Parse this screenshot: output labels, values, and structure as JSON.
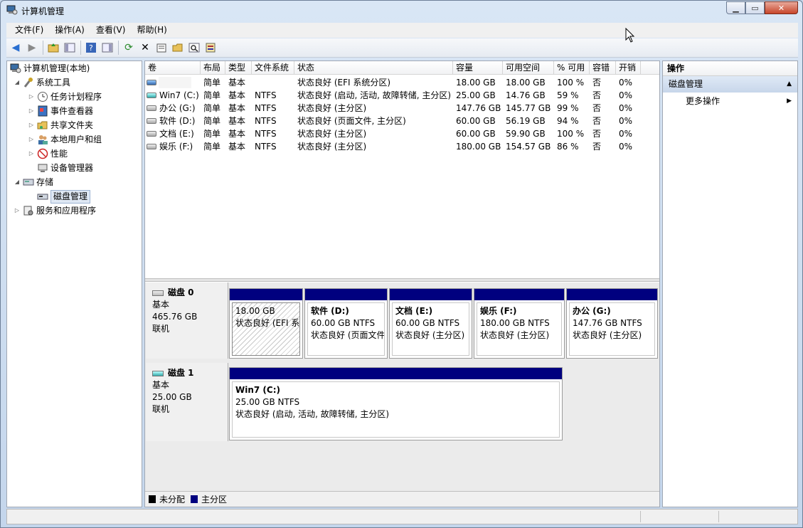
{
  "window": {
    "title": "计算机管理"
  },
  "menu": [
    "文件(F)",
    "操作(A)",
    "查看(V)",
    "帮助(H)"
  ],
  "tree": {
    "root": "计算机管理(本地)",
    "system_tools": "系统工具",
    "task_scheduler": "任务计划程序",
    "event_viewer": "事件查看器",
    "shared_folders": "共享文件夹",
    "local_users": "本地用户和组",
    "performance": "性能",
    "device_manager": "设备管理器",
    "storage": "存储",
    "disk_management": "磁盘管理",
    "services_apps": "服务和应用程序"
  },
  "volumes": {
    "headers": [
      "卷",
      "布局",
      "类型",
      "文件系统",
      "状态",
      "容量",
      "可用空间",
      "% 可用",
      "容错",
      "开销"
    ],
    "rows": [
      [
        "",
        "简单",
        "基本",
        "",
        "状态良好 (EFI 系统分区)",
        "18.00 GB",
        "18.00 GB",
        "100 %",
        "否",
        "0%"
      ],
      [
        "Win7 (C:)",
        "简单",
        "基本",
        "NTFS",
        "状态良好 (启动, 活动, 故障转储, 主分区)",
        "25.00 GB",
        "14.76 GB",
        "59 %",
        "否",
        "0%"
      ],
      [
        "办公 (G:)",
        "简单",
        "基本",
        "NTFS",
        "状态良好 (主分区)",
        "147.76 GB",
        "145.77 GB",
        "99 %",
        "否",
        "0%"
      ],
      [
        "软件 (D:)",
        "简单",
        "基本",
        "NTFS",
        "状态良好 (页面文件, 主分区)",
        "60.00 GB",
        "56.19 GB",
        "94 %",
        "否",
        "0%"
      ],
      [
        "文档 (E:)",
        "简单",
        "基本",
        "NTFS",
        "状态良好 (主分区)",
        "60.00 GB",
        "59.90 GB",
        "100 %",
        "否",
        "0%"
      ],
      [
        "娱乐 (F:)",
        "简单",
        "基本",
        "NTFS",
        "状态良好 (主分区)",
        "180.00 GB",
        "154.57 GB",
        "86 %",
        "否",
        "0%"
      ]
    ]
  },
  "disks": [
    {
      "name": "磁盘 0",
      "type": "基本",
      "size": "465.76 GB",
      "status": "联机",
      "partitions": [
        {
          "name": "",
          "size": "18.00 GB",
          "status": "状态良好 (EFI 系统分区)"
        },
        {
          "name": "软件  (D:)",
          "size": "60.00 GB NTFS",
          "status": "状态良好 (页面文件, 主分区)"
        },
        {
          "name": "文档  (E:)",
          "size": "60.00 GB NTFS",
          "status": "状态良好 (主分区)"
        },
        {
          "name": "娱乐  (F:)",
          "size": "180.00 GB NTFS",
          "status": "状态良好 (主分区)"
        },
        {
          "name": "办公  (G:)",
          "size": "147.76 GB NTFS",
          "status": "状态良好 (主分区)"
        }
      ]
    },
    {
      "name": "磁盘 1",
      "type": "基本",
      "size": "25.00 GB",
      "status": "联机",
      "partitions": [
        {
          "name": "Win7  (C:)",
          "size": "25.00 GB NTFS",
          "status": "状态良好 (启动, 活动, 故障转储, 主分区)"
        }
      ]
    }
  ],
  "legend": {
    "unallocated": "未分配",
    "primary": "主分区"
  },
  "actions": {
    "header": "操作",
    "section": "磁盘管理",
    "more": "更多操作"
  },
  "colors": {
    "primary_partition": "#00007f",
    "unallocated": "#000000"
  }
}
